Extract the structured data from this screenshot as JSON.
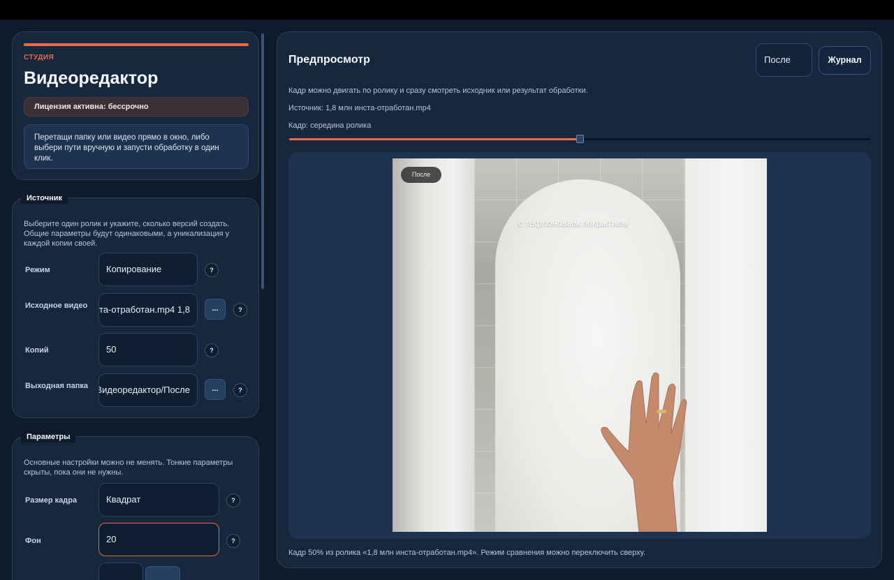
{
  "studio": {
    "eyebrow": "СТУДИЯ",
    "title": "Видеоредактор",
    "license": "Лицензия активна: бессрочно",
    "hint": "Перетащи папку или видео прямо в окно, либо выбери пути вручную и запусти обработку в один клик."
  },
  "source": {
    "legend": "Источник",
    "description": "Выберите один ролик и укажите, сколько версий создать. Общие параметры будут одинаковыми, а уникализация у каждой копии своей.",
    "mode_label": "Режим",
    "mode_value": "Копирование",
    "video_label": "Исходное видео",
    "video_value": "1,8 млн инста-отработан.mp4",
    "copies_label": "Копий",
    "copies_value": "50",
    "output_label": "Выходная папка",
    "output_value": "Видеоредактор/После",
    "browse": "...",
    "help": "?"
  },
  "params": {
    "legend": "Параметры",
    "description": "Основные настройки можно не менять. Тонкие параметры скрыты, пока они не нужны.",
    "frame_label": "Размер кадра",
    "frame_value": "Квадрат",
    "bg_label": "Фон",
    "bg_value": "20",
    "help": "?"
  },
  "preview": {
    "title": "Предпросмотр",
    "mode_value": "После",
    "log_button": "Журнал",
    "info": "Кадр можно двигать по ролику и сразу смотреть исходник или результат обработки.",
    "source_line": "Источник: 1,8 млн инста-отработан.mp4",
    "frame_line": "Кадр: середина ролика",
    "slider_fraction": 0.5,
    "badge": "После",
    "caption": "с тефлоновым покрытием",
    "footnote": "Кадр 50% из ролика «1,8 млн инста-отработан.mp4». Режим сравнения можно переключить сверху."
  },
  "colors": {
    "accent": "#f06a45",
    "background": "#0f1b2b",
    "card": "#17273d"
  }
}
